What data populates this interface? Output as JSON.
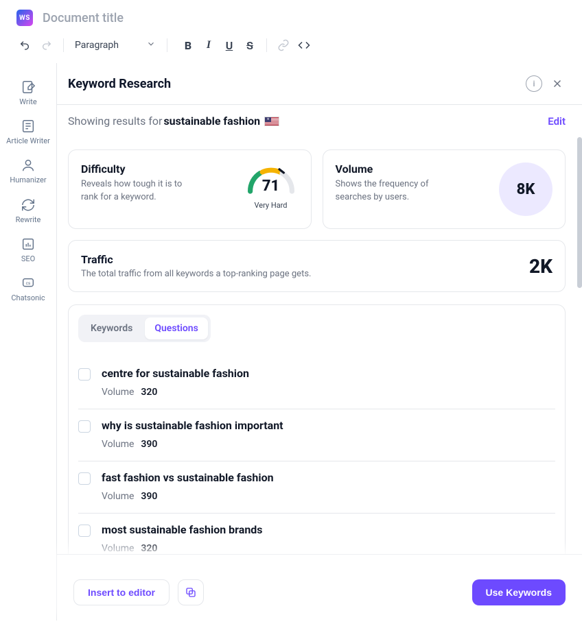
{
  "header": {
    "logo_text": "WS",
    "doc_title": "Document title"
  },
  "toolbar": {
    "style_select": "Paragraph"
  },
  "sidebar": {
    "items": [
      {
        "label": "Write"
      },
      {
        "label": "Article Writer"
      },
      {
        "label": "Humanizer"
      },
      {
        "label": "Rewrite"
      },
      {
        "label": "SEO"
      },
      {
        "label": "Chatsonic"
      }
    ]
  },
  "panel": {
    "title": "Keyword Research"
  },
  "results": {
    "prefix": "Showing results for ",
    "keyword": "sustainable fashion",
    "edit_label": "Edit"
  },
  "difficulty": {
    "title": "Difficulty",
    "desc": "Reveals how tough it is to rank for a keyword.",
    "value": "71",
    "label": "Very Hard"
  },
  "volume": {
    "title": "Volume",
    "desc": "Shows the frequency of searches by users.",
    "value": "8K"
  },
  "traffic": {
    "title": "Traffic",
    "desc": "The total traffic from all keywords a top-ranking page gets.",
    "value": "2K"
  },
  "tabs": {
    "keywords": "Keywords",
    "questions": "Questions"
  },
  "questions": [
    {
      "text": "centre for sustainable fashion",
      "volume_label": "Volume",
      "volume": "320"
    },
    {
      "text": "why is sustainable fashion important",
      "volume_label": "Volume",
      "volume": "390"
    },
    {
      "text": "fast fashion vs sustainable fashion",
      "volume_label": "Volume",
      "volume": "390"
    },
    {
      "text": "most sustainable fashion brands",
      "volume_label": "Volume",
      "volume": "320"
    }
  ],
  "actions": {
    "insert": "Insert to editor",
    "use": "Use Keywords"
  }
}
